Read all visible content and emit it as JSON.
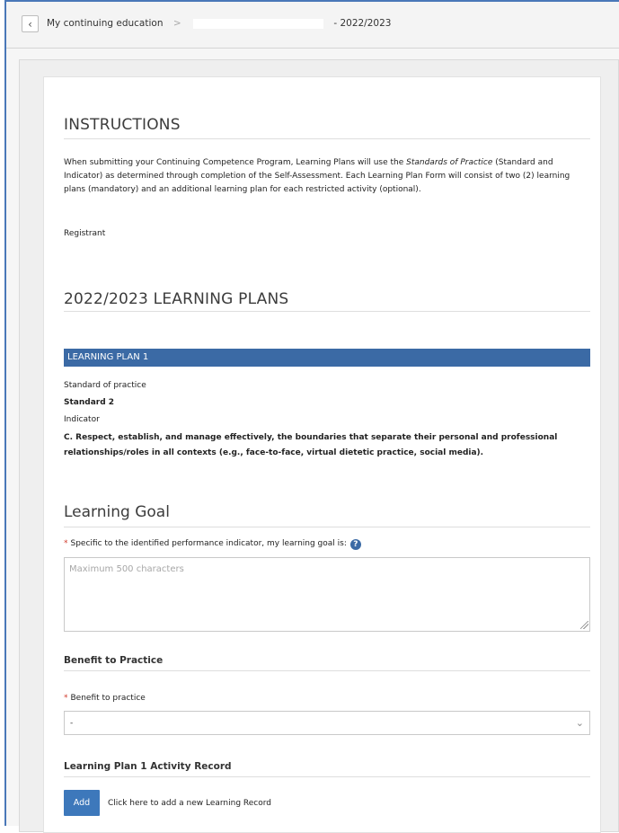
{
  "breadcrumb": {
    "back_icon": "chevron-left-icon",
    "root": "My continuing education",
    "separator": ">",
    "current": "- 2022/2023"
  },
  "instructions": {
    "title": "INSTRUCTIONS",
    "text_before_italic": "When submitting your Continuing Competence Program, Learning Plans will use the ",
    "text_italic": "Standards of Practice",
    "text_after_italic": " (Standard and Indicator) as determined through completion of the Self-Assessment. Each Learning Plan Form will consist of two (2) learning plans (mandatory) and an additional learning plan for each restricted activity (optional).",
    "registrant_label": "Registrant"
  },
  "learning_plans": {
    "title": "2022/2023 LEARNING PLANS",
    "plan1": {
      "header": "LEARNING PLAN 1",
      "standard_label": "Standard of practice",
      "standard_value": "Standard 2",
      "indicator_label": "Indicator",
      "indicator_value": "C. Respect, establish, and manage effectively, the boundaries that separate their personal and professional relationships/roles in all contexts (e.g., face-to-face, virtual dietetic practice, social media)."
    }
  },
  "learning_goal": {
    "title": "Learning Goal",
    "required_mark": "*",
    "prompt": "Specific to the identified performance indicator, my learning goal is:",
    "help_icon_glyph": "?",
    "placeholder": "Maximum 500 characters"
  },
  "benefit": {
    "title": "Benefit to Practice",
    "required_mark": "*",
    "label": "Benefit to practice",
    "selected": "-"
  },
  "activity_record": {
    "title": "Learning Plan 1 Activity Record",
    "add_label": "Add",
    "hint": "Click here to add a new Learning Record"
  },
  "colors": {
    "accent": "#3b6aa5",
    "button": "#3d78bb",
    "required": "#d0392b"
  }
}
